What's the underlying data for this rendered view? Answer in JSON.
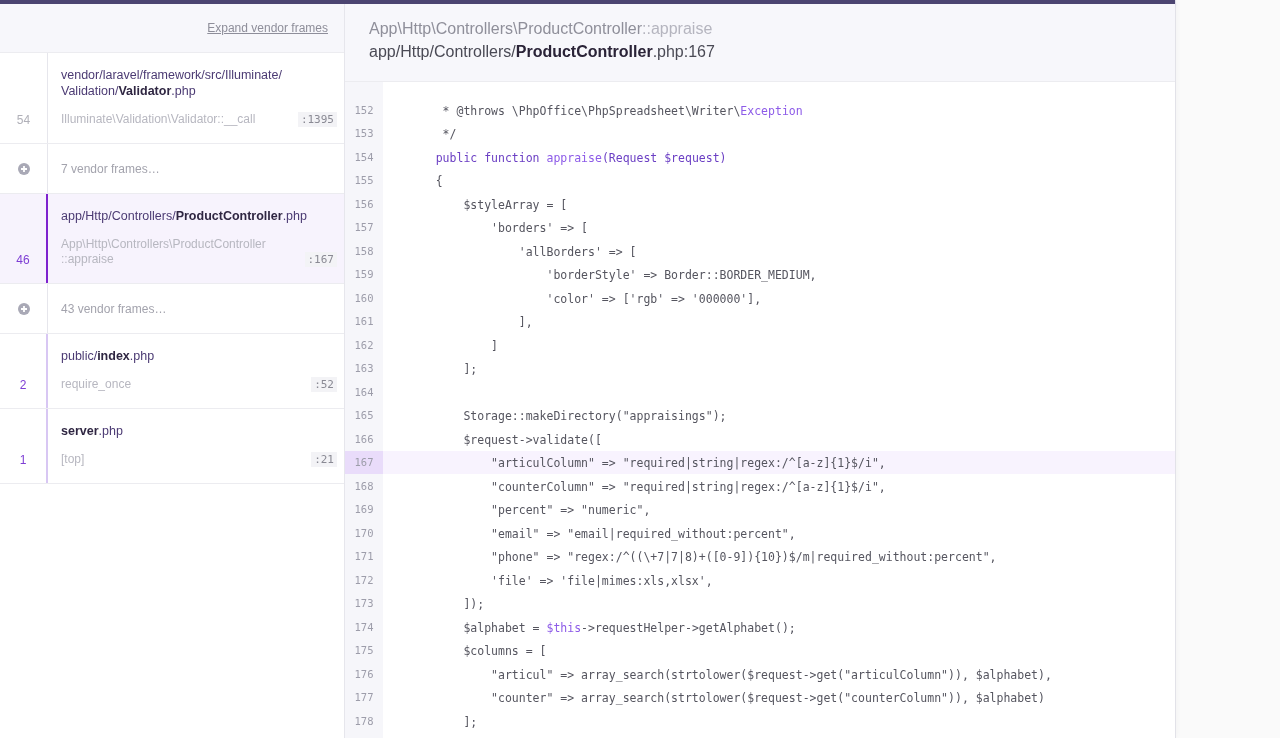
{
  "sidebar": {
    "expand_link": "Expand vendor frames",
    "frames": [
      {
        "kind": "frame",
        "number": "54",
        "file": "vendor/laravel/framework/src/Illuminate/Validation/**Validator**.php",
        "method": "Illuminate\\Validation\\Validator::__call",
        "line": ":1395",
        "vendor": true,
        "selected": false
      },
      {
        "kind": "vendor_group",
        "label": "7 vendor frames…"
      },
      {
        "kind": "frame",
        "number": "46",
        "file": "app/Http/Controllers/**ProductController**.php",
        "method": "App\\Http\\Controllers\\ProductController::appraise",
        "line": ":167",
        "vendor": false,
        "selected": true
      },
      {
        "kind": "vendor_group",
        "label": "43 vendor frames…"
      },
      {
        "kind": "frame",
        "number": "2",
        "file": "public/**index**.php",
        "method": "require_once",
        "line": ":52",
        "vendor": false,
        "selected": false
      },
      {
        "kind": "frame",
        "number": "1",
        "file": "**server**.php",
        "method": "[top]",
        "line": ":21",
        "vendor": false,
        "selected": false
      }
    ]
  },
  "header": {
    "class": "App\\Http\\Controllers\\ProductController",
    "method": "::appraise",
    "file": "app/Http/Controllers/**ProductController**.php:167"
  },
  "code": [
    {
      "number": "152",
      "highlighted": false,
      "segments": [
        {
          "text": "     * @throws \\PhpOffice\\PhpSpreadsheet\\Writer\\",
          "kind": "plain"
        },
        {
          "text": "Exception",
          "kind": "name"
        }
      ]
    },
    {
      "number": "153",
      "highlighted": false,
      "segments": [
        {
          "text": "     */",
          "kind": "plain"
        }
      ]
    },
    {
      "number": "154",
      "highlighted": false,
      "segments": [
        {
          "text": "    public function ",
          "kind": "keyword"
        },
        {
          "text": "appraise",
          "kind": "name"
        },
        {
          "text": "(Request $request)",
          "kind": "keyword"
        }
      ]
    },
    {
      "number": "155",
      "highlighted": false,
      "segments": [
        {
          "text": "    {",
          "kind": "plain"
        }
      ]
    },
    {
      "number": "156",
      "highlighted": false,
      "segments": [
        {
          "text": "        $styleArray = [",
          "kind": "plain"
        }
      ]
    },
    {
      "number": "157",
      "highlighted": false,
      "segments": [
        {
          "text": "            'borders' => [",
          "kind": "plain"
        }
      ]
    },
    {
      "number": "158",
      "highlighted": false,
      "segments": [
        {
          "text": "                'allBorders' => [",
          "kind": "plain"
        }
      ]
    },
    {
      "number": "159",
      "highlighted": false,
      "segments": [
        {
          "text": "                    'borderStyle' => Border::BORDER_MEDIUM,",
          "kind": "plain"
        }
      ]
    },
    {
      "number": "160",
      "highlighted": false,
      "segments": [
        {
          "text": "                    'color' => ['rgb' => '000000'],",
          "kind": "plain"
        }
      ]
    },
    {
      "number": "161",
      "highlighted": false,
      "segments": [
        {
          "text": "                ],",
          "kind": "plain"
        }
      ]
    },
    {
      "number": "162",
      "highlighted": false,
      "segments": [
        {
          "text": "            ]",
          "kind": "plain"
        }
      ]
    },
    {
      "number": "163",
      "highlighted": false,
      "segments": [
        {
          "text": "        ];",
          "kind": "plain"
        }
      ]
    },
    {
      "number": "164",
      "highlighted": false
    },
    {
      "number": "165",
      "highlighted": false,
      "segments": [
        {
          "text": "        Storage::makeDirectory(\"appraisings\");",
          "kind": "plain"
        }
      ]
    },
    {
      "number": "166",
      "highlighted": false,
      "segments": [
        {
          "text": "        $request->validate([",
          "kind": "plain"
        }
      ]
    },
    {
      "number": "167",
      "highlighted": true,
      "segments": [
        {
          "text": "            \"articulColumn\" => \"required|string|regex:/^[a-z]{1}$/i\",",
          "kind": "plain"
        }
      ]
    },
    {
      "number": "168",
      "highlighted": false,
      "segments": [
        {
          "text": "            \"counterColumn\" => \"required|string|regex:/^[a-z]{1}$/i\",",
          "kind": "plain"
        }
      ]
    },
    {
      "number": "169",
      "highlighted": false,
      "segments": [
        {
          "text": "            \"percent\" => \"numeric\",",
          "kind": "plain"
        }
      ]
    },
    {
      "number": "170",
      "highlighted": false,
      "segments": [
        {
          "text": "            \"email\" => \"email|required_without:percent\",",
          "kind": "plain"
        }
      ]
    },
    {
      "number": "171",
      "highlighted": false,
      "segments": [
        {
          "text": "            \"phone\" => \"regex:/^((\\+7|7|8)+([0-9]){10})$/m|required_without:percent\",",
          "kind": "plain"
        }
      ]
    },
    {
      "number": "172",
      "highlighted": false,
      "segments": [
        {
          "text": "            'file' => 'file|mimes:xls,xlsx',",
          "kind": "plain"
        }
      ]
    },
    {
      "number": "173",
      "highlighted": false,
      "segments": [
        {
          "text": "        ]);",
          "kind": "plain"
        }
      ]
    },
    {
      "number": "174",
      "highlighted": false,
      "segments": [
        {
          "text": "        $alphabet = ",
          "kind": "plain"
        },
        {
          "text": "$this",
          "kind": "name"
        },
        {
          "text": "->requestHelper->getAlphabet();",
          "kind": "plain"
        }
      ]
    },
    {
      "number": "175",
      "highlighted": false,
      "segments": [
        {
          "text": "        $columns = [",
          "kind": "plain"
        }
      ]
    },
    {
      "number": "176",
      "highlighted": false,
      "segments": [
        {
          "text": "            \"articul\" => array_search(strtolower($request->get(\"articulColumn\")), $alphabet),",
          "kind": "plain"
        }
      ]
    },
    {
      "number": "177",
      "highlighted": false,
      "segments": [
        {
          "text": "            \"counter\" => array_search(strtolower($request->get(\"counterColumn\")), $alphabet)",
          "kind": "plain"
        }
      ]
    },
    {
      "number": "178",
      "highlighted": false,
      "segments": [
        {
          "text": "        ];",
          "kind": "plain"
        }
      ]
    }
  ]
}
